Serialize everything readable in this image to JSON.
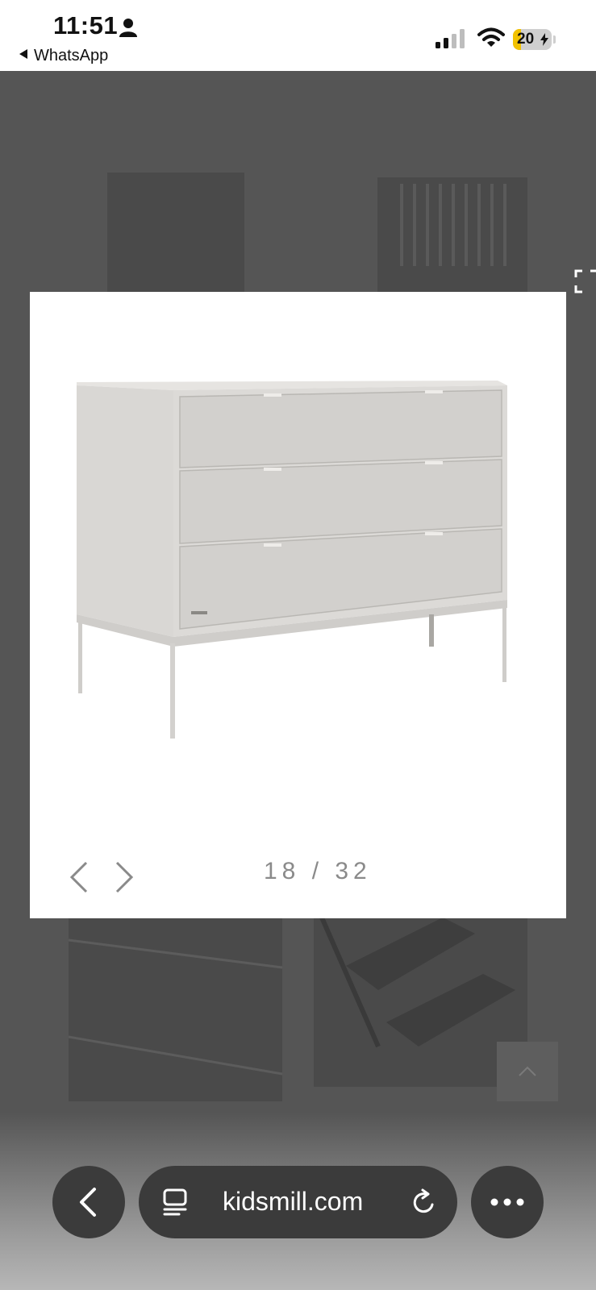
{
  "status_bar": {
    "time": "11:51",
    "back_app": "WhatsApp",
    "battery": "20"
  },
  "lightbox": {
    "counter": "18 / 32",
    "current_image": 18,
    "total_images": 32
  },
  "browser": {
    "url": "kidsmill.com"
  },
  "icons": [
    "person-icon",
    "signal-icon",
    "wifi-icon",
    "battery-icon",
    "expand-icon",
    "chevron-left-icon",
    "chevron-right-icon",
    "chevron-up-icon",
    "back-icon",
    "tabs-icon",
    "reload-icon",
    "more-icon"
  ],
  "colors": {
    "overlay": "#555555",
    "lightbox_bg": "#ffffff",
    "counter_text": "#8a8a8a",
    "toolbar_button": "#3b3b3b",
    "battery_accent": "#f2c200"
  }
}
